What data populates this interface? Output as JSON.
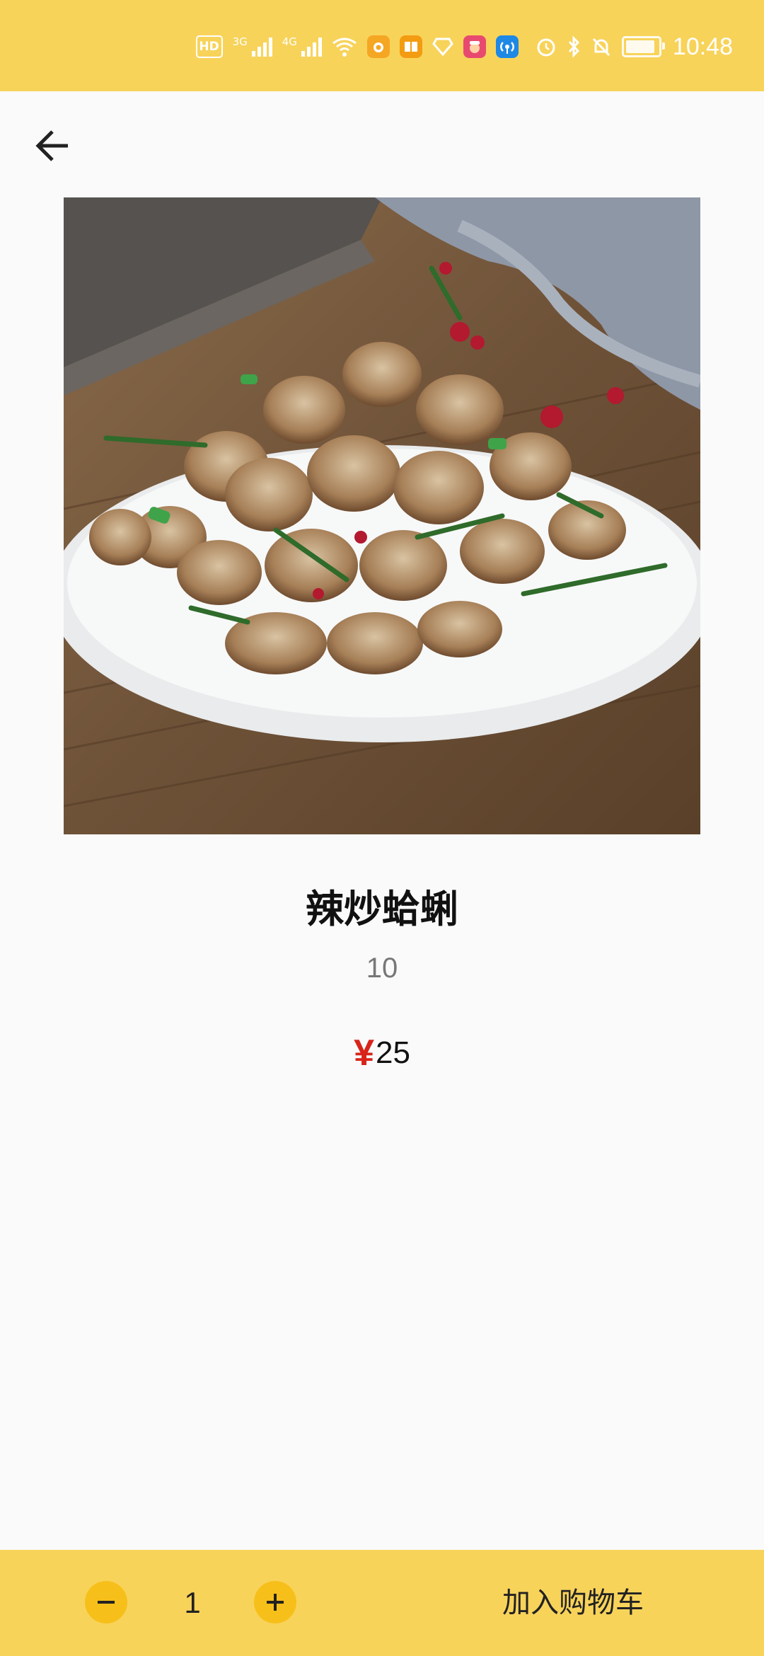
{
  "status_bar": {
    "time": "10:48",
    "hd_label": "HD",
    "net_3g": "3G",
    "net_4g": "4G",
    "battery_level": 0.9,
    "icons": [
      "hd-icon",
      "signal-3g-icon",
      "signal-4g-icon",
      "wifi-icon",
      "app-icon-orange",
      "app-icon-reader",
      "app-icon-diamond",
      "app-icon-pink",
      "app-icon-hotspot",
      "alarm-icon",
      "bluetooth-icon",
      "mute-icon",
      "battery-icon"
    ]
  },
  "header": {
    "back_icon": "arrow-left-icon"
  },
  "product": {
    "name": "辣炒蛤蜊",
    "sales": "10",
    "currency_symbol": "¥",
    "price": "25"
  },
  "cart_bar": {
    "minus_icon": "minus-icon",
    "plus_icon": "plus-icon",
    "quantity": "1",
    "add_to_cart_label": "加入购物车"
  },
  "colors": {
    "accent_yellow": "#f8d35a",
    "button_yellow": "#f7bf1a",
    "price_red": "#d8241a",
    "background": "#fafafa"
  }
}
